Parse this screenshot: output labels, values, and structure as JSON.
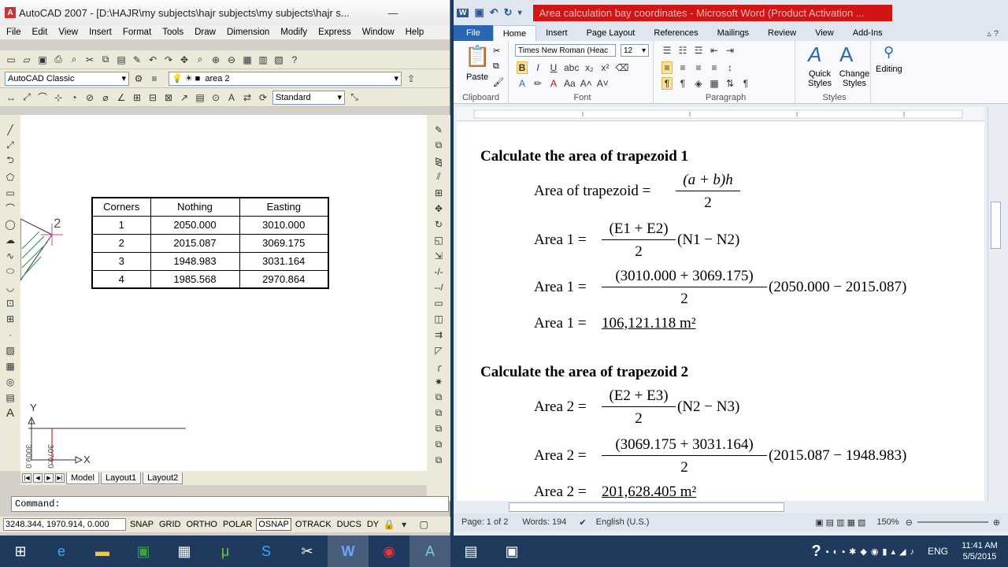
{
  "acad": {
    "title": "AutoCAD 2007 - [D:\\HAJR\\my subjects\\hajr subjects\\my subjects\\hajr s...",
    "menu": [
      "File",
      "Edit",
      "View",
      "Insert",
      "Format",
      "Tools",
      "Draw",
      "Dimension",
      "Modify",
      "Express",
      "Window",
      "Help"
    ],
    "workspace": "AutoCAD Classic",
    "layer": "area 2",
    "text_style": "Standard",
    "table": {
      "headers": [
        "Corners",
        "Nothing",
        "Easting"
      ],
      "rows": [
        [
          "1",
          "2050.000",
          "3010.000"
        ],
        [
          "2",
          "2015.087",
          "3069.175"
        ],
        [
          "3",
          "1948.983",
          "3031.164"
        ],
        [
          "4",
          "1985.568",
          "2970.864"
        ]
      ]
    },
    "drawing_label": "2",
    "axis_y": "Y",
    "axis_x": "X",
    "dim_text_1": "3009.0",
    "dim_text_2": "3070.0",
    "layout_tabs": [
      "Model",
      "Layout1",
      "Layout2"
    ],
    "command_prompt": "Command:",
    "coords": "3248.344, 1970.914, 0.000",
    "status_toggles": [
      "SNAP",
      "GRID",
      "ORTHO",
      "POLAR",
      "OSNAP",
      "OTRACK",
      "DUCS",
      "DY"
    ]
  },
  "word": {
    "title": "Area calculation bay coordinates - Microsoft Word (Product Activation ...",
    "tabs": [
      "File",
      "Home",
      "Insert",
      "Page Layout",
      "References",
      "Mailings",
      "Review",
      "View",
      "Add-Ins"
    ],
    "font_name": "Times New Roman (Heac",
    "font_size": "12",
    "groups": {
      "clipboard": "Clipboard",
      "font": "Font",
      "paragraph": "Paragraph",
      "styles": "Styles"
    },
    "paste": "Paste",
    "quick_styles": "Quick Styles",
    "change_styles": "Change Styles",
    "editing": "Editing",
    "doc": {
      "heading1": "Calculate the area of trapezoid 1",
      "eq1_lhs": "Area of trapezoid =",
      "eq1_num": "(a + b)h",
      "eq1_den": "2",
      "eq2_lhs": "Area 1 =",
      "eq2_num": "(E1 + E2)",
      "eq2_den": "2",
      "eq2_rhs": "(N1 − N2)",
      "eq3_lhs": "Area 1 =",
      "eq3_num": "(3010.000 + 3069.175)",
      "eq3_den": "2",
      "eq3_rhs": "(2050.000 − 2015.087)",
      "res1_lhs": "Area 1 =",
      "res1_val": "106,121.118 m²",
      "heading2": "Calculate the area of trapezoid 2",
      "eq4_lhs": "Area 2 =",
      "eq4_num": "(E2 + E3)",
      "eq4_den": "2",
      "eq4_rhs": "(N2 − N3)",
      "eq5_lhs": "Area 2 =",
      "eq5_num": "(3069.175 + 3031.164)",
      "eq5_den": "2",
      "eq5_rhs": "(2015.087 − 1948.983)",
      "res2_lhs": "Area 2 =",
      "res2_val": "201,628.405 m²"
    },
    "status": {
      "page": "Page: 1 of 2",
      "words": "Words: 194",
      "lang": "English (U.S.)",
      "zoom": "150%"
    }
  },
  "tray": {
    "lang": "ENG",
    "time": "11:41 AM",
    "date": "5/5/2015"
  }
}
